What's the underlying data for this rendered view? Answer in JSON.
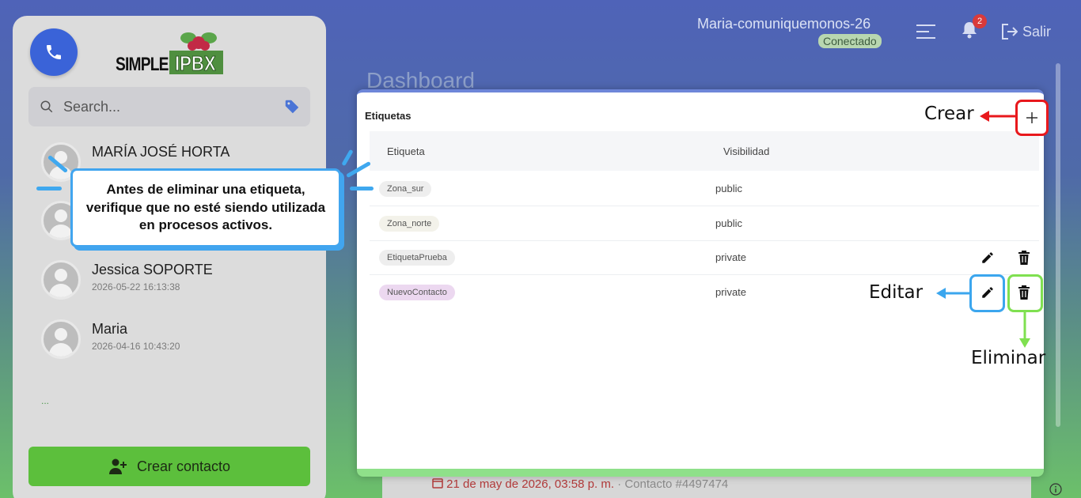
{
  "sidebar": {
    "logo_text_left": "SIMPLE",
    "logo_text_right": "IPBX",
    "search_placeholder": "Search...",
    "contacts": [
      {
        "name": "MARÍA JOSÉ HORTA",
        "time": ""
      },
      {
        "name": "",
        "time": ""
      },
      {
        "name": "Jessica SOPORTE",
        "time": "2026-05-22 16:13:38"
      },
      {
        "name": "Maria",
        "time": "2026-04-16 10:43:20"
      }
    ],
    "more_indicator": "...",
    "create_contact_label": "Crear contacto"
  },
  "header": {
    "user_name": "Maria-comuniquemonos-26",
    "status": "Conectado",
    "notification_count": "2",
    "logout_label": "Salir"
  },
  "page": {
    "title": "Dashboard",
    "behind_date": "21 de may de 2026, 03:58 p. m.",
    "behind_contact": "· Contacto #4497474"
  },
  "modal": {
    "title": "Etiquetas",
    "columns": [
      "Etiqueta",
      "Visibilidad"
    ],
    "rows": [
      {
        "tag": "Zona_sur",
        "visibility": "public"
      },
      {
        "tag": "Zona_norte",
        "visibility": "public"
      },
      {
        "tag": "EtiquetaPrueba",
        "visibility": "private"
      },
      {
        "tag": "NuevoContacto",
        "visibility": "private"
      }
    ]
  },
  "annotations": {
    "create": "Crear",
    "edit": "Editar",
    "delete": "Eliminar",
    "callout": "Antes de eliminar una etiqueta, verifique que no esté siendo utilizada en procesos activos."
  },
  "colors": {
    "create_highlight": "#e8181c",
    "edit_highlight": "#3ba6ee",
    "delete_highlight": "#7fe050",
    "callout_border": "#41a5ef"
  }
}
